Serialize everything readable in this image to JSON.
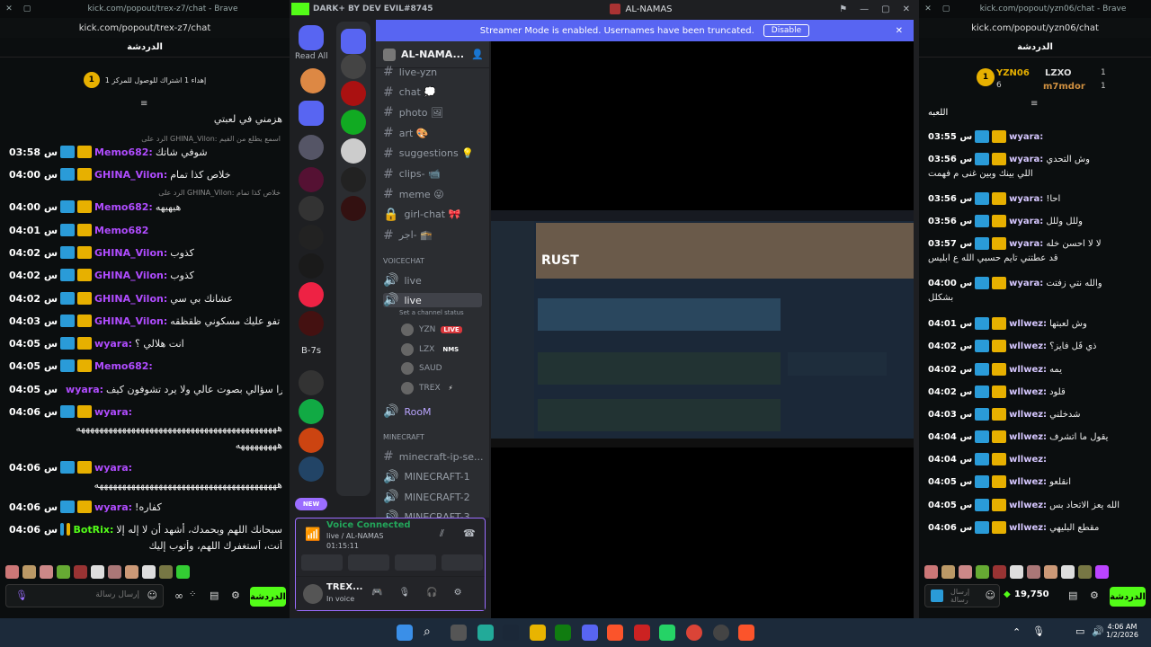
{
  "left_window": {
    "tab_close": "×",
    "url_title": "kick.com/popout/trex-z7/chat - Brave",
    "address": "kick.com/popout/trex-z7/chat",
    "title": "الدردشة",
    "pinned": "إهداء 1 اشتراك للوصول للمركز 1",
    "pinned_rank": "1",
    "messages": [
      {
        "time": "",
        "user": "",
        "text": "هزمني في لعبتي",
        "color": "#ffffff"
      },
      {
        "reply": "الرد على GHINA_Vilon: اسمع يطلع من الفيم"
      },
      {
        "time": "03:58 س",
        "user": "Memo682:",
        "text": "شوفي شاتك",
        "color": "#b04cff"
      },
      {
        "time": "04:00 س",
        "user": "GHINA_Vilon:",
        "text": "خلاص كذا تمام",
        "color": "#b04cff"
      },
      {
        "reply": "الرد على GHINA_Vilon: خلاص كذا تمام"
      },
      {
        "time": "04:00 س",
        "user": "Memo682:",
        "text": "هيهيهه",
        "color": "#b04cff"
      },
      {
        "time": "04:01 س",
        "user": "Memo682",
        "text": "",
        "color": "#b04cff"
      },
      {
        "time": "04:02 س",
        "user": "GHINA_Vilon:",
        "text": "كذوب",
        "color": "#b04cff"
      },
      {
        "time": "04:02 س",
        "user": "GHINA_Vilon:",
        "text": "كذوب",
        "color": "#b04cff"
      },
      {
        "time": "04:02 س",
        "user": "GHINA_Vilon:",
        "text": "عشانك بي سي",
        "color": "#b04cff"
      },
      {
        "time": "04:03 س",
        "user": "GHINA_Vilon:",
        "text": "تفو عليك مسكوني ظقظقه",
        "color": "#b04cff"
      },
      {
        "time": "04:05 س",
        "user": "wyara:",
        "text": "انت هلالي ؟",
        "color": "#b04cff"
      },
      {
        "time": "04:05 س",
        "user": "Memo682:",
        "text": "",
        "color": "#b04cff"
      },
      {
        "time": "04:05 س",
        "user": "wyara:",
        "text": "يقرا سؤالي بصوت عالي ولا يرد تشوفون كيف",
        "color": "#b04cff"
      },
      {
        "time": "04:06 س",
        "user": "wyara:",
        "text": "",
        "color": "#b04cff"
      },
      {
        "time": "",
        "user": "",
        "text": "ههههههههههههههههههههههههههههههههههههههههههههه",
        "color": "#ffffff"
      },
      {
        "time": "",
        "user": "",
        "text": "هههههههههه",
        "color": "#ffffff"
      },
      {
        "time": "04:06 س",
        "user": "wyara:",
        "text": "",
        "color": "#b04cff"
      },
      {
        "time": "",
        "user": "",
        "text": "ههههههههههههههههههههههههههههههههههههههههه",
        "color": "#ffffff"
      },
      {
        "time": "04:06 س",
        "user": "wyara:",
        "text": "كفاره!",
        "color": "#b04cff"
      },
      {
        "time": "04:06 س",
        "user": "BotRix:",
        "text": "سبحانك اللهم وبحمدك، أشهد أن لا إله إلا",
        "color": "#53fc18"
      },
      {
        "time": "",
        "user": "",
        "text": "أنت، أستغفرك اللهم، وأتوب إليك",
        "color": "#ffffff"
      }
    ],
    "input_placeholder": "إرسال رسالة",
    "chat_button": "الدردشة"
  },
  "discord": {
    "title_left": "DARK+ BY DEV EVIL#8745",
    "title_server": "AL-NAMAS",
    "read_all": "Read All",
    "new_badge": "NEW",
    "server_label": "B-7s",
    "banner_text": "Streamer Mode is enabled. Usernames have been truncated.",
    "banner_button": "Disable",
    "server_name": "AL-NAMA...",
    "channels": [
      {
        "icon": "#",
        "name": "live-yzn"
      },
      {
        "icon": "#",
        "name": "chat 💭"
      },
      {
        "icon": "#",
        "name": "photo 🖼"
      },
      {
        "icon": "#",
        "name": "art 🎨"
      },
      {
        "icon": "#",
        "name": "suggestions 💡"
      },
      {
        "icon": "#",
        "name": "clips- 📹"
      },
      {
        "icon": "#",
        "name": "meme 😜"
      },
      {
        "icon": "🔒",
        "name": "girl-chat 🎀"
      },
      {
        "icon": "#",
        "name": "اجر- 🕋"
      }
    ],
    "voice_category": "VOICECHAT",
    "voice_channels": [
      "live",
      "live",
      "RooM"
    ],
    "set_status": "Set a channel status",
    "voice_users": [
      {
        "name": "YZN",
        "badge": "LIVE"
      },
      {
        "name": "LZX",
        "badge": "NMS"
      },
      {
        "name": "SAUD",
        "badge": ""
      },
      {
        "name": "TREX",
        "badge": "⚡"
      }
    ],
    "mc_category": "MINECRAFT",
    "mc_channels": [
      {
        "icon": "#",
        "name": "minecraft-ip-se..."
      },
      {
        "icon": "🔊",
        "name": "MINECRAFT-1"
      },
      {
        "icon": "🔊",
        "name": "MINECRAFT-2"
      },
      {
        "icon": "🔊",
        "name": "MINECRAFT-3"
      }
    ],
    "vc_status": "Voice Connected",
    "vc_channel": "live / AL-NAMAS",
    "vc_timer": "01:15:11",
    "user_name": "TREX...",
    "user_status": "In voice",
    "stream_logo": "RUST"
  },
  "right_window": {
    "url_title": "kick.com/popout/yzn06/chat - Brave",
    "address": "kick.com/popout/yzn06/chat",
    "title": "الدردشة",
    "top1": "YZN06",
    "top1_count": "6",
    "top2": "LZXO",
    "top2_count": "1",
    "top3": "m7mdor",
    "top3_count": "1",
    "rank": "1",
    "header_msg": "اللعبه",
    "messages": [
      {
        "time": "03:55 س",
        "user": "wyara:",
        "text": ""
      },
      {
        "time": "03:56 س",
        "user": "wyara:",
        "text": "وش التحدي"
      },
      {
        "time": "",
        "user": "",
        "text": "اللي بينك وبين غنى م فهمت"
      },
      {
        "time": "03:56 س",
        "user": "wyara:",
        "text": "احا!"
      },
      {
        "time": "03:56 س",
        "user": "wyara:",
        "text": "وللل وللل"
      },
      {
        "time": "03:57 س",
        "user": "wyara:",
        "text": "لا لا احسن خله"
      },
      {
        "time": "",
        "user": "",
        "text": "قد عطتني تايم حسبي الله ع ابليس"
      },
      {
        "time": "04:00 س",
        "user": "wyara:",
        "text": "والله نتي زفتت"
      },
      {
        "time": "",
        "user": "",
        "text": "بشكلل"
      },
      {
        "time": "04:01 س",
        "user": "wllwez:",
        "text": "وش لعبتها"
      },
      {
        "time": "04:02 س",
        "user": "wllwez:",
        "text": "ذي فَل فايز؟"
      },
      {
        "time": "04:02 س",
        "user": "wllwez:",
        "text": "يمه"
      },
      {
        "time": "04:02 س",
        "user": "wllwez:",
        "text": "قلود"
      },
      {
        "time": "04:03 س",
        "user": "wllwez:",
        "text": "شدخلني"
      },
      {
        "time": "04:04 س",
        "user": "wllwez:",
        "text": "يقول ما اتشرف"
      },
      {
        "time": "04:04 س",
        "user": "wllwez:",
        "text": ""
      },
      {
        "time": "04:05 س",
        "user": "wllwez:",
        "text": "انقلعو"
      },
      {
        "time": "04:05 س",
        "user": "wllwez:",
        "text": "الله يعز الاتحاد بس"
      },
      {
        "time": "04:06 س",
        "user": "wllwez:",
        "text": "مقطع البليهي"
      }
    ],
    "input_placeholder": "إرسال رسالة",
    "points": "19,750",
    "chat_button": "الدردشة"
  },
  "taskbar": {
    "time": "4:06 AM",
    "date": "1/2/2026"
  },
  "colors": {
    "kick_green": "#53fc18",
    "discord_blurple": "#5865f2",
    "purple_name": "#b04cff"
  }
}
